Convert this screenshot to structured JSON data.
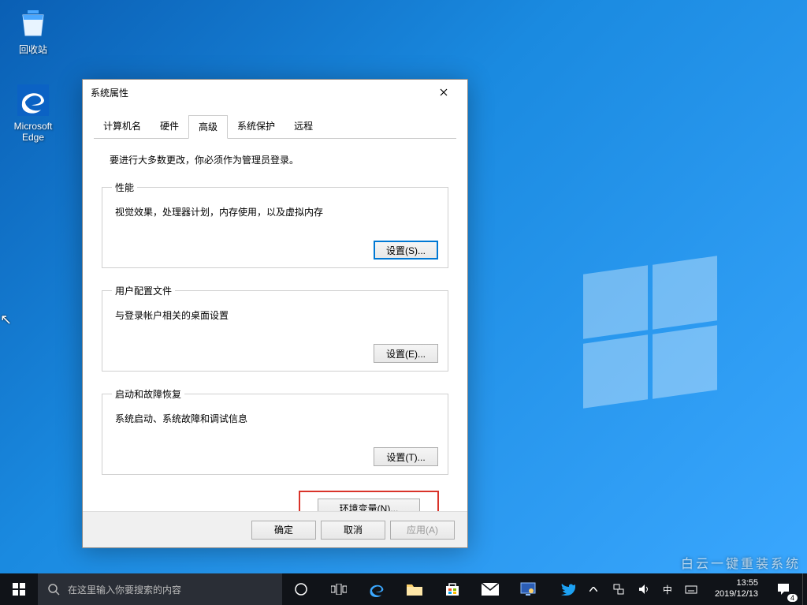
{
  "desktop": {
    "icons": [
      {
        "name": "recycle-bin",
        "label": "回收站"
      },
      {
        "name": "edge",
        "label": "Microsoft Edge"
      }
    ]
  },
  "dialog": {
    "title": "系统属性",
    "tabs": [
      "计算机名",
      "硬件",
      "高级",
      "系统保护",
      "远程"
    ],
    "active_tab_index": 2,
    "admin_note": "要进行大多数更改，你必须作为管理员登录。",
    "groups": {
      "performance": {
        "legend": "性能",
        "desc": "视觉效果，处理器计划，内存使用，以及虚拟内存",
        "button": "设置(S)..."
      },
      "user_profiles": {
        "legend": "用户配置文件",
        "desc": "与登录帐户相关的桌面设置",
        "button": "设置(E)..."
      },
      "startup": {
        "legend": "启动和故障恢复",
        "desc": "系统启动、系统故障和调试信息",
        "button": "设置(T)..."
      }
    },
    "env_button": "环境变量(N)...",
    "footer": {
      "ok": "确定",
      "cancel": "取消",
      "apply": "应用(A)"
    }
  },
  "taskbar": {
    "search_placeholder": "在这里输入你要搜索的内容",
    "ime": "中",
    "time": "13:55",
    "date": "2019/12/13",
    "notif_count": "4"
  },
  "watermark": "白云一键重装系统"
}
